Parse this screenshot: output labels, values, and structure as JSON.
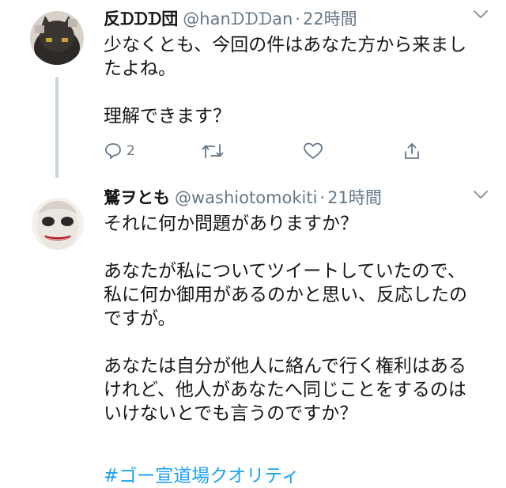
{
  "tweet1": {
    "display_name": "反ᗪᗪᗪ団",
    "handle": "@hanᗪᗪᗪan",
    "dot": "·",
    "time": "22時間",
    "text": "少なくとも、今回の件はあなた方から来ましたよね。\n\n理解できます？",
    "actions": {
      "reply_count": "2"
    }
  },
  "tweet2": {
    "display_name": "鷲ヲとも",
    "handle": "@washiotomokiti",
    "dot": "·",
    "time": "21時間",
    "text": "それに何か問題がありますか？\n\nあなたが私についてツイートしていたので、私に何か御用があるのかと思い、反応したのですが。\n\nあなたは自分が他人に絡んで行く権利はあるけれど、他人があなたへ同じことをするのはいけないとでも言うのですか？",
    "hashtag": "#ゴー宣道場クオリティ"
  },
  "colors": {
    "text": "#14171a",
    "secondary": "#657786",
    "link": "#1da1f2",
    "thread_line": "#ccd6dd"
  },
  "icons": [
    "chevron-down-icon",
    "reply-icon",
    "retweet-icon",
    "like-icon",
    "share-icon"
  ]
}
